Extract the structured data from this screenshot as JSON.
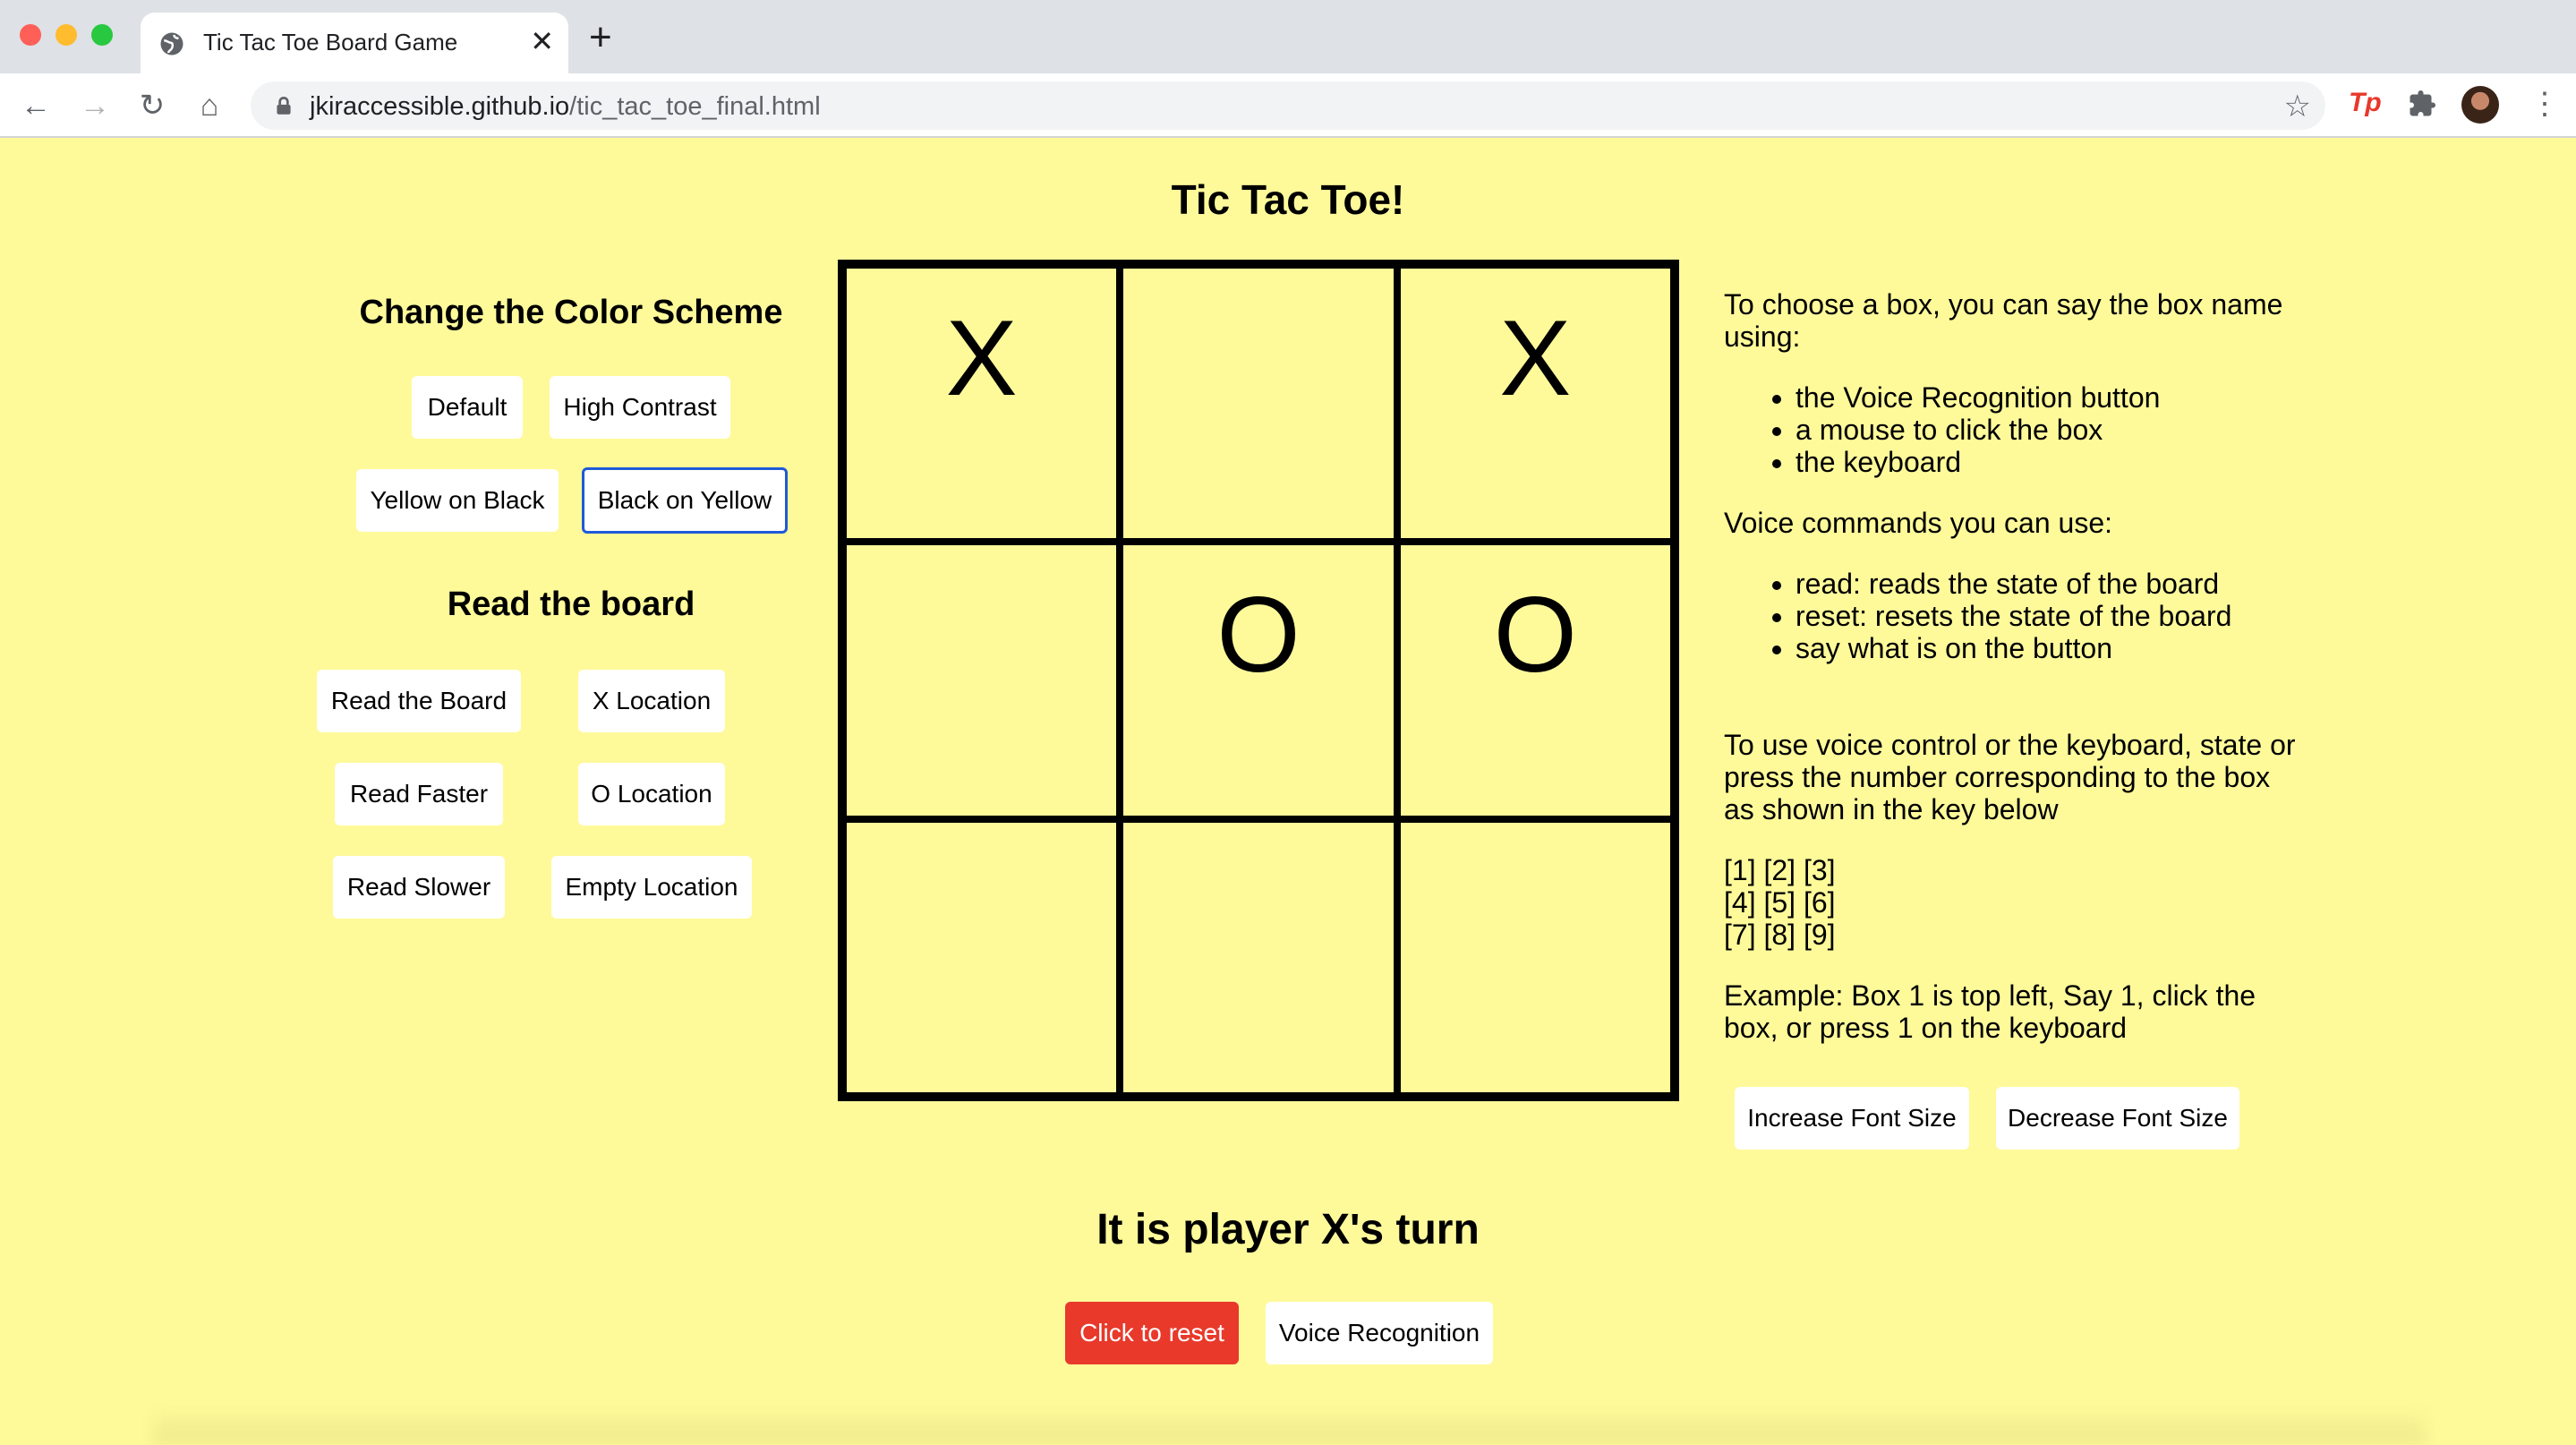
{
  "browser": {
    "tab_title": "Tic Tac Toe Board Game",
    "url_host": "jkiraccessible.github.io",
    "url_path": "/tic_tac_toe_final.html",
    "extension_tp": "Tp"
  },
  "page": {
    "title": "Tic Tac Toe!",
    "color_scheme": {
      "heading": "Change the Color Scheme",
      "buttons": [
        "Default",
        "High Contrast",
        "Yellow on Black",
        "Black on Yellow"
      ],
      "selected": "Black on Yellow"
    },
    "read_board": {
      "heading": "Read the board",
      "buttons": [
        "Read the Board",
        "X Location",
        "Read Faster",
        "O Location",
        "Read Slower",
        "Empty Location"
      ]
    },
    "board": {
      "cells": [
        "X",
        "",
        "X",
        "",
        "O",
        "O",
        "",
        "",
        ""
      ]
    },
    "help": {
      "intro": "To choose a box, you can say the box name using:",
      "methods": [
        "the Voice Recognition button",
        "a mouse to click the box",
        "the keyboard"
      ],
      "voice_intro": "Voice commands you can use:",
      "commands": [
        "read: reads the state of the board",
        "reset: resets the state of the board",
        "say what is on the button"
      ],
      "instructions": "To use voice control or the keyboard, state or press the number corresponding to the box as shown in the key below",
      "key_row1": "[1] [2] [3]",
      "key_row2": "[4] [5] [6]",
      "key_row3": "[7] [8] [9]",
      "example": "Example: Box 1 is top left, Say 1, click the box, or press 1 on the keyboard"
    },
    "font_buttons": [
      "Increase Font Size",
      "Decrease Font Size"
    ],
    "turn_text": "It is player X's turn",
    "reset_label": "Click to reset",
    "voice_label": "Voice Recognition"
  },
  "colors": {
    "page_bg": "#fefa9a",
    "reset_bg": "#e8392b",
    "selected_border": "#1f5ad8"
  }
}
